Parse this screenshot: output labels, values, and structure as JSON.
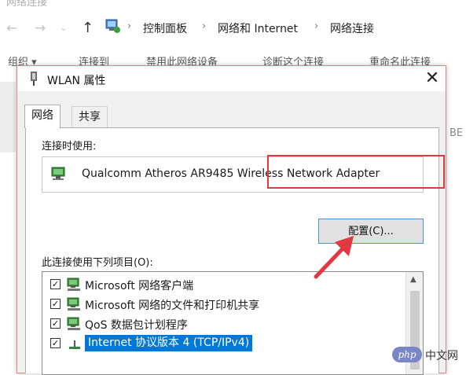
{
  "window_title": "网络连接",
  "breadcrumb": [
    "控制面板",
    "网络和 Internet",
    "网络连接"
  ],
  "toolbar": [
    "组织 ▾",
    "连接到",
    "禁用此网络设备",
    "诊断这个连接",
    "重命名此连接"
  ],
  "right_text": "BE",
  "dialog": {
    "title": "WLAN 属性",
    "tabs": [
      "网络",
      "共享"
    ],
    "connect_using_label": "连接时使用:",
    "adapter_name": "Qualcomm Atheros AR9485 Wireless Network Adapter",
    "configure_button": "配置(C)...",
    "items_label": "此连接使用下列项目(O):",
    "items": [
      {
        "label": "Microsoft 网络客户端",
        "checked": true,
        "selected": false
      },
      {
        "label": "Microsoft 网络的文件和打印机共享",
        "checked": true,
        "selected": false
      },
      {
        "label": "QoS 数据包计划程序",
        "checked": true,
        "selected": false
      },
      {
        "label": "Internet 协议版本 4 (TCP/IPv4)",
        "checked": true,
        "selected": true
      }
    ]
  },
  "watermark": {
    "logo": "php",
    "text": "中文网"
  },
  "colors": {
    "highlight": "#e2383f",
    "selection": "#0078d7",
    "button_border": "#4d8fd9"
  }
}
